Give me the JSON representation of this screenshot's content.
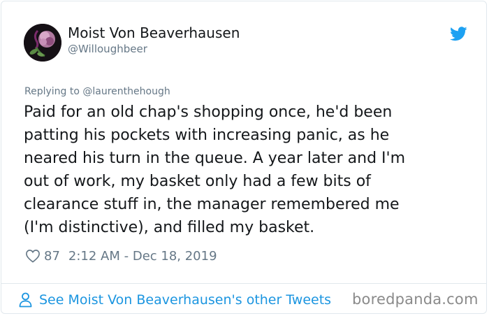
{
  "author": {
    "display_name": "Moist Von Beaverhausen",
    "handle": "@Willoughbeer",
    "avatar_icon": "flower-avatar"
  },
  "brand": {
    "icon": "twitter-bird-icon",
    "color": "#1da1f2"
  },
  "reply_to": {
    "prefix": "Replying to ",
    "mention": "@laurenthehough"
  },
  "tweet": {
    "lines": [
      "Paid for an old chap's shopping once, he'd been",
      "patting his pockets with increasing panic, as he",
      "neared his turn in the queue. A year later and I'm",
      "out of work, my basket only had a few bits of",
      "clearance stuff in, the manager remembered me",
      "(I'm distinctive), and filled my basket."
    ]
  },
  "meta": {
    "likes": "87",
    "timestamp": "2:12 AM - Dec 18, 2019"
  },
  "footer": {
    "link_label": "See Moist Von Beaverhausen's other Tweets",
    "link_color": "#1b95e0"
  },
  "watermark": "boredpanda.com"
}
